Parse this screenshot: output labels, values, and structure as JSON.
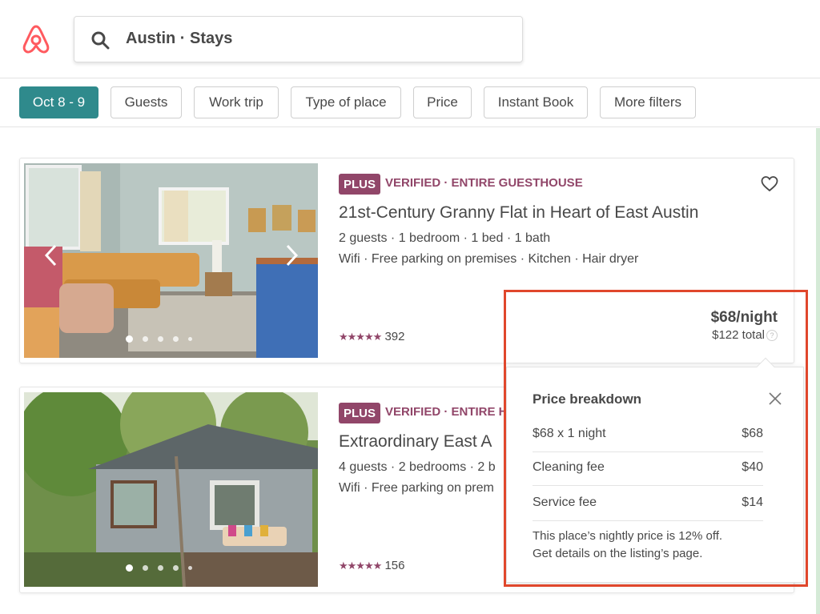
{
  "header": {
    "search_text": "Austin · Stays"
  },
  "filters": [
    {
      "label": "Oct 8 - 9",
      "active": true
    },
    {
      "label": "Guests"
    },
    {
      "label": "Work trip"
    },
    {
      "label": "Type of place"
    },
    {
      "label": "Price"
    },
    {
      "label": "Instant Book"
    },
    {
      "label": "More filters"
    }
  ],
  "listings": [
    {
      "badge": "PLUS",
      "verified": "VERIFIED · ENTIRE GUESTHOUSE",
      "title": "21st-Century Granny Flat in Heart of East Austin",
      "details": "2 guests · 1 bedroom · 1 bed · 1 bath",
      "amenities": "Wifi · Free parking on premises · Kitchen · Hair dryer",
      "stars": "★★★★★",
      "reviews": "392",
      "price_night": "$68/night",
      "price_total": "$122 total"
    },
    {
      "badge": "PLUS",
      "verified": "VERIFIED · ENTIRE H",
      "title": "Extraordinary East A",
      "details": "4 guests · 2 bedrooms · 2 b",
      "amenities": "Wifi · Free parking on prem",
      "stars": "★★★★★",
      "reviews": "156"
    }
  ],
  "price_breakdown": {
    "title": "Price breakdown",
    "rows": [
      {
        "label": "$68 x 1 night",
        "amount": "$68"
      },
      {
        "label": "Cleaning fee",
        "amount": "$40"
      },
      {
        "label": "Service fee",
        "amount": "$14"
      }
    ],
    "note_line1": "This place’s nightly price is 12% off.",
    "note_line2": "Get details on the listing’s page."
  },
  "colors": {
    "brand": "#ff5a5f",
    "teal": "#2f8a8c",
    "plum": "#914669",
    "highlight": "#e0472c"
  },
  "icons": [
    "airbnb-logo-icon",
    "search-icon",
    "heart-icon",
    "chevron-left-icon",
    "chevron-right-icon",
    "close-icon",
    "question-icon"
  ]
}
